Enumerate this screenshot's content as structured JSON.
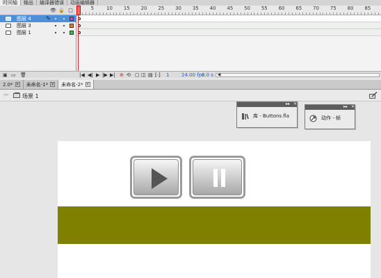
{
  "panel_tabs": [
    {
      "label": "时间轴",
      "active": true
    },
    {
      "label": "输出",
      "active": false
    },
    {
      "label": "编译器错误",
      "active": false
    },
    {
      "label": "动画编辑器",
      "active": false
    }
  ],
  "timeline": {
    "layers": [
      {
        "name": "图层 4",
        "selected": true,
        "color": "#b44cd8"
      },
      {
        "name": "图层 3",
        "selected": false,
        "color": "#f07a2a"
      },
      {
        "name": "图层 1",
        "selected": false,
        "color": "#33c13a"
      }
    ],
    "ruler_labels": [
      "1",
      "5",
      "10",
      "15",
      "20",
      "25",
      "30",
      "35",
      "40",
      "45",
      "50",
      "55",
      "60",
      "65",
      "70",
      "75",
      "80",
      "85"
    ],
    "current_frame": "1",
    "fps": "24.00 fps",
    "time": "0.0 s"
  },
  "doc_tabs": [
    {
      "label": "2.0*",
      "active": false
    },
    {
      "label": "未命名-1*",
      "active": false
    },
    {
      "label": "未命名-2*",
      "active": true
    }
  ],
  "scene": {
    "label": "场景 1"
  },
  "library_panel": {
    "title": "库 - Buttons.fla"
  },
  "actions_panel": {
    "title": "动作 - 帧"
  },
  "stage": {
    "background": "#ffffff",
    "bar_color": "#808000"
  }
}
